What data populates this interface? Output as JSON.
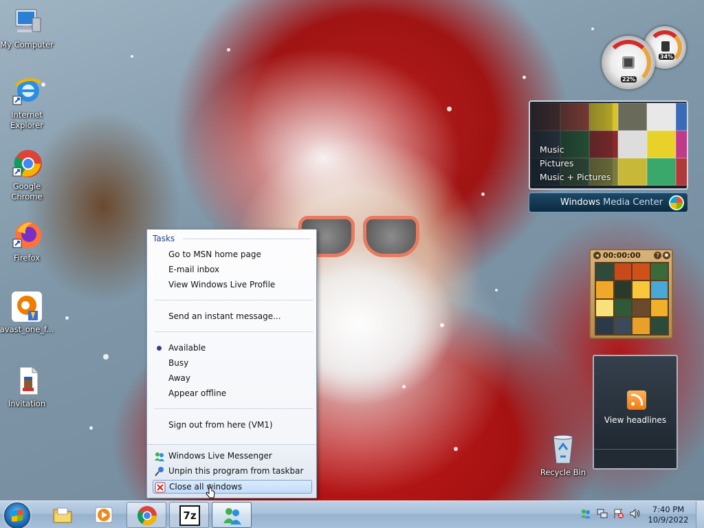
{
  "desktop": {
    "icons": [
      {
        "label": "My Computer"
      },
      {
        "label": "Internet Explorer"
      },
      {
        "label": "Google Chrome"
      },
      {
        "label": "Firefox"
      },
      {
        "label": "avast_one_f..."
      },
      {
        "label": "Invitation"
      },
      {
        "label": "Recycle Bin"
      }
    ]
  },
  "jumplist": {
    "header": "Tasks",
    "items": [
      "Go to MSN home page",
      "E-mail inbox",
      "View Windows Live Profile",
      "Send an instant message...",
      "Available",
      "Busy",
      "Away",
      "Appear offline",
      "Sign out from here (VM1)"
    ],
    "selected_status": "Available",
    "bottom_tasks": [
      {
        "label": "Windows Live Messenger",
        "icon": "messenger-icon"
      },
      {
        "label": "Unpin this program from taskbar",
        "icon": "unpin-icon"
      },
      {
        "label": "Close all windows",
        "icon": "close-windows-icon"
      }
    ]
  },
  "gadgets": {
    "cpu_meter": {
      "cpu_percent": "22%",
      "memory_percent": "34%"
    },
    "media_center": {
      "menu": [
        "Music",
        "Pictures",
        "Music + Pictures"
      ],
      "title_prefix": "Windows",
      "title_suffix": " Media Center"
    },
    "puzzle": {
      "timer": "00:00:00",
      "help": "?"
    },
    "feeds": {
      "label": "View headlines"
    }
  },
  "taskbar": {
    "buttons": [
      {
        "name": "explorer",
        "icon": "folder-icon"
      },
      {
        "name": "media-player",
        "icon": "media-player-icon"
      },
      {
        "name": "chrome",
        "icon": "chrome-icon"
      },
      {
        "name": "7zip",
        "icon": "7zip-icon",
        "text": "7z"
      },
      {
        "name": "messenger",
        "icon": "messenger-icon"
      }
    ],
    "clock": {
      "time": "7:40 PM",
      "date": "10/9/2022"
    }
  },
  "colors": {
    "jumplist_header": "#1e3f8a",
    "taskbar": "#a9c1da",
    "highlight": "#c1dbfc"
  }
}
